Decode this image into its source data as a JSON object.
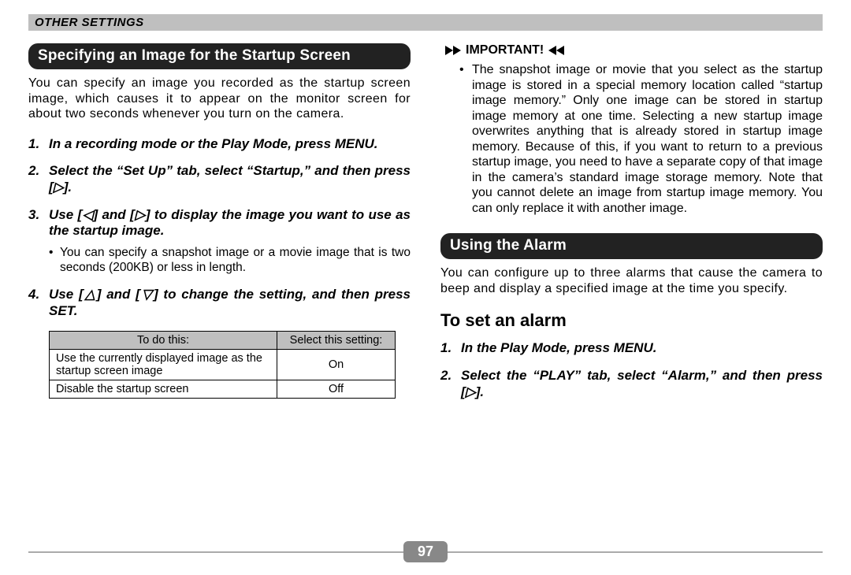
{
  "header": "OTHER SETTINGS",
  "left": {
    "heading": "Specifying an Image for the Startup Screen",
    "intro": "You can specify an image you recorded as the startup screen image, which causes it to appear on the monitor screen for about two seconds whenever you turn on the camera.",
    "steps": [
      "In a recording mode or the Play Mode, press MENU.",
      "Select the “Set Up” tab, select “Startup,” and then press [▷].",
      "Use [◁] and [▷] to display the image you want to use as the startup image.",
      "Use [△] and [▽] to change the setting, and then press SET."
    ],
    "step3_bullets": [
      "You can specify a snapshot image or a movie image that is two seconds (200KB) or less in length."
    ],
    "table": {
      "headers": [
        "To do this:",
        "Select this setting:"
      ],
      "rows": [
        [
          "Use the currently displayed image as the startup screen image",
          "On"
        ],
        [
          "Disable the startup screen",
          "Off"
        ]
      ]
    }
  },
  "right": {
    "important_label": "IMPORTANT!",
    "important_text": "The snapshot image or movie that you select as the startup image is stored in a special memory location called “startup image memory.” Only one image can be stored in startup image memory at one time. Selecting a new startup image overwrites anything that is already stored in startup image memory. Because of this, if you want to return to a previous startup image, you need to have a separate copy of that image in the camera’s standard image storage memory. Note that you cannot delete an image from startup image memory. You can only replace it with another image.",
    "heading2": "Using the Alarm",
    "alarm_intro": "You can configure up to three alarms that cause the camera to beep and display a specified image at the time you specify.",
    "subheading": "To set an alarm",
    "alarm_steps": [
      "In the Play Mode, press MENU.",
      "Select the “PLAY” tab, select “Alarm,” and then press [▷]."
    ]
  },
  "page_number": "97"
}
